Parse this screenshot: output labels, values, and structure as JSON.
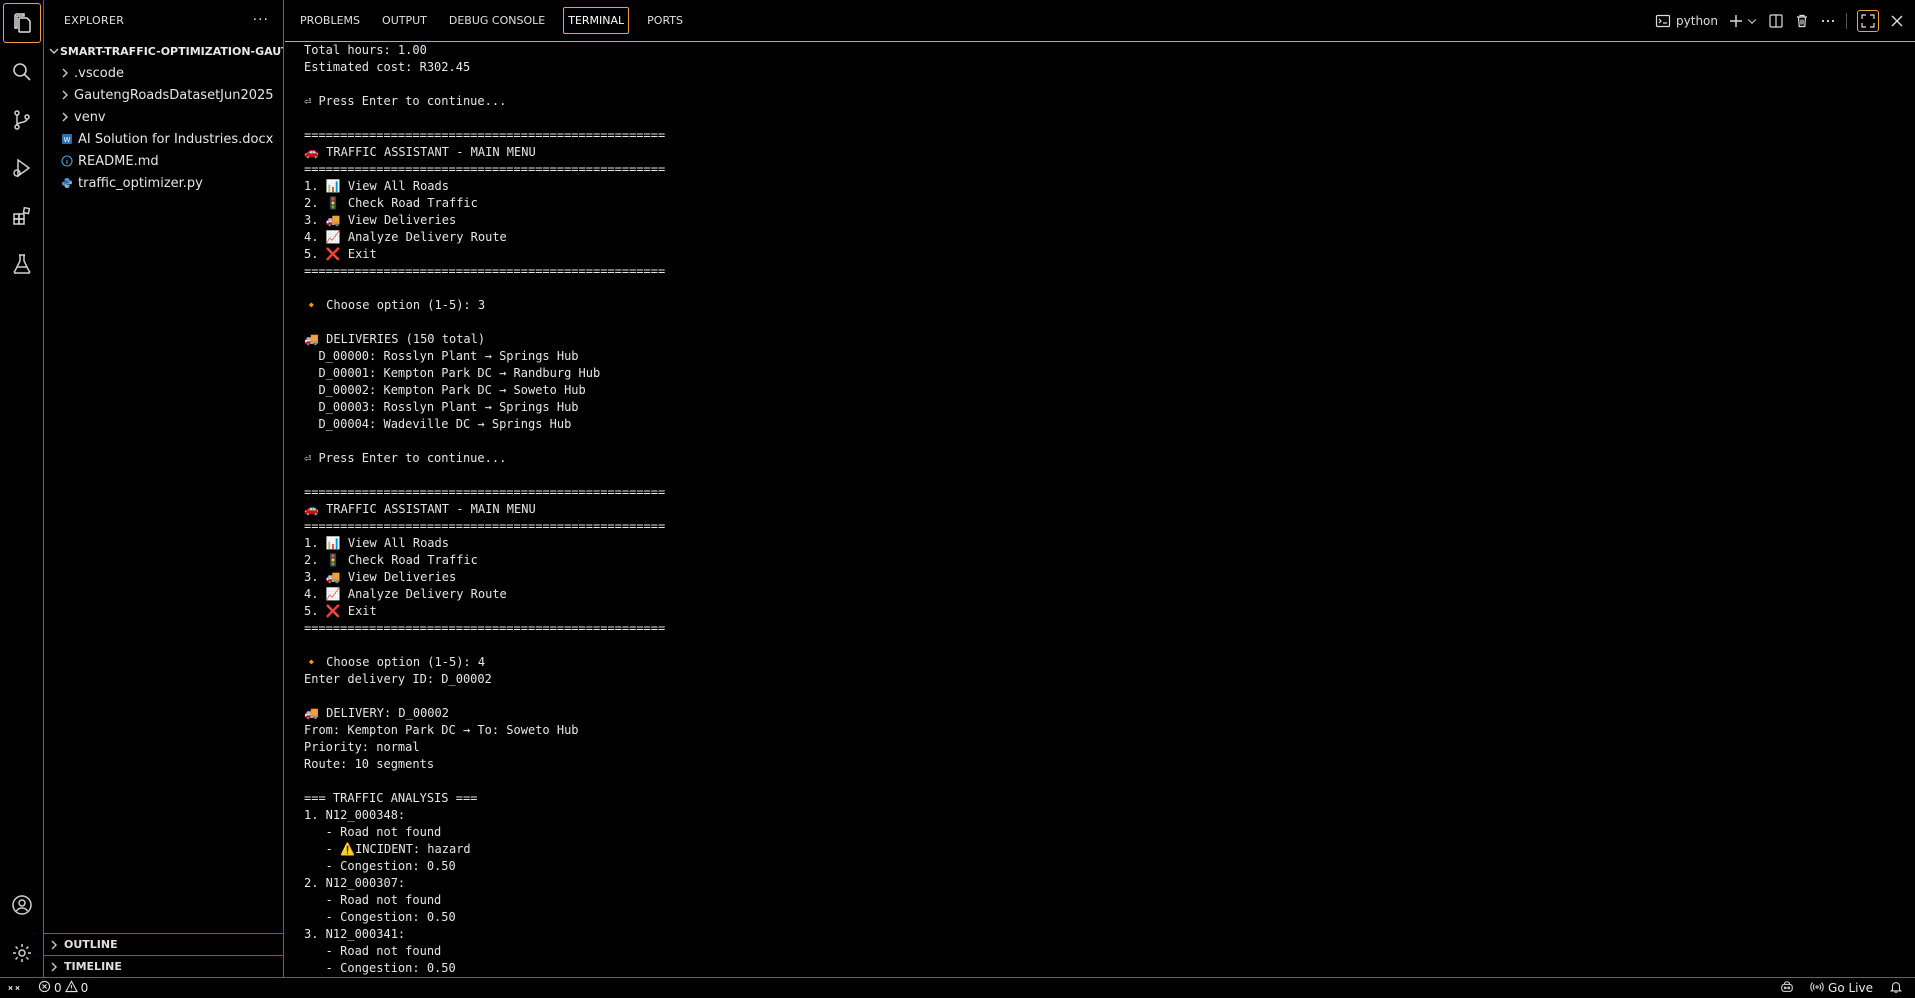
{
  "sidebar": {
    "title": "EXPLORER",
    "more": "···",
    "root": "SMART-TRAFFIC-OPTIMIZATION-GAUT...",
    "items": [
      {
        "label": ".vscode",
        "type": "folder"
      },
      {
        "label": "GautengRoadsDatasetJun2025",
        "type": "folder"
      },
      {
        "label": "venv",
        "type": "folder"
      },
      {
        "label": "AI Solution for Industries.docx",
        "type": "docx"
      },
      {
        "label": "README.md",
        "type": "info"
      },
      {
        "label": "traffic_optimizer.py",
        "type": "python"
      }
    ],
    "outline": "OUTLINE",
    "timeline": "TIMELINE"
  },
  "panel": {
    "tabs": [
      "PROBLEMS",
      "OUTPUT",
      "DEBUG CONSOLE",
      "TERMINAL",
      "PORTS"
    ],
    "active_tab": "TERMINAL",
    "terminal_name": "python"
  },
  "terminal": {
    "lines": [
      "Total hours: 1.00",
      "Estimated cost: R302.45",
      "",
      "⏎ Press Enter to continue...",
      "",
      "==================================================",
      "🚗 TRAFFIC ASSISTANT - MAIN MENU",
      "==================================================",
      "1. 📊 View All Roads",
      "2. 🚦 Check Road Traffic",
      "3. 🚚 View Deliveries",
      "4. 📈 Analyze Delivery Route",
      "5. ❌ Exit",
      "==================================================",
      "",
      "🔸 Choose option (1-5): 3",
      "",
      "🚚 DELIVERIES (150 total)",
      "  D_00000: Rosslyn Plant → Springs Hub",
      "  D_00001: Kempton Park DC → Randburg Hub",
      "  D_00002: Kempton Park DC → Soweto Hub",
      "  D_00003: Rosslyn Plant → Springs Hub",
      "  D_00004: Wadeville DC → Springs Hub",
      "",
      "⏎ Press Enter to continue...",
      "",
      "==================================================",
      "🚗 TRAFFIC ASSISTANT - MAIN MENU",
      "==================================================",
      "1. 📊 View All Roads",
      "2. 🚦 Check Road Traffic",
      "3. 🚚 View Deliveries",
      "4. 📈 Analyze Delivery Route",
      "5. ❌ Exit",
      "==================================================",
      "",
      "🔸 Choose option (1-5): 4",
      "Enter delivery ID: D_00002",
      "",
      "🚚 DELIVERY: D_00002",
      "From: Kempton Park DC → To: Soweto Hub",
      "Priority: normal",
      "Route: 10 segments",
      "",
      "=== TRAFFIC ANALYSIS ===",
      "1. N12_000348:",
      "   - Road not found",
      "   - ⚠️INCIDENT: hazard",
      "   - Congestion: 0.50",
      "2. N12_000307:",
      "   - Road not found",
      "   - Congestion: 0.50",
      "3. N12_000341:",
      "   - Road not found",
      "   - Congestion: 0.50"
    ]
  },
  "status": {
    "errors": "0",
    "warnings": "0",
    "golive": "Go Live"
  },
  "colors": {
    "accent_border": "#f0a040",
    "separator": "#2b6fb3"
  }
}
